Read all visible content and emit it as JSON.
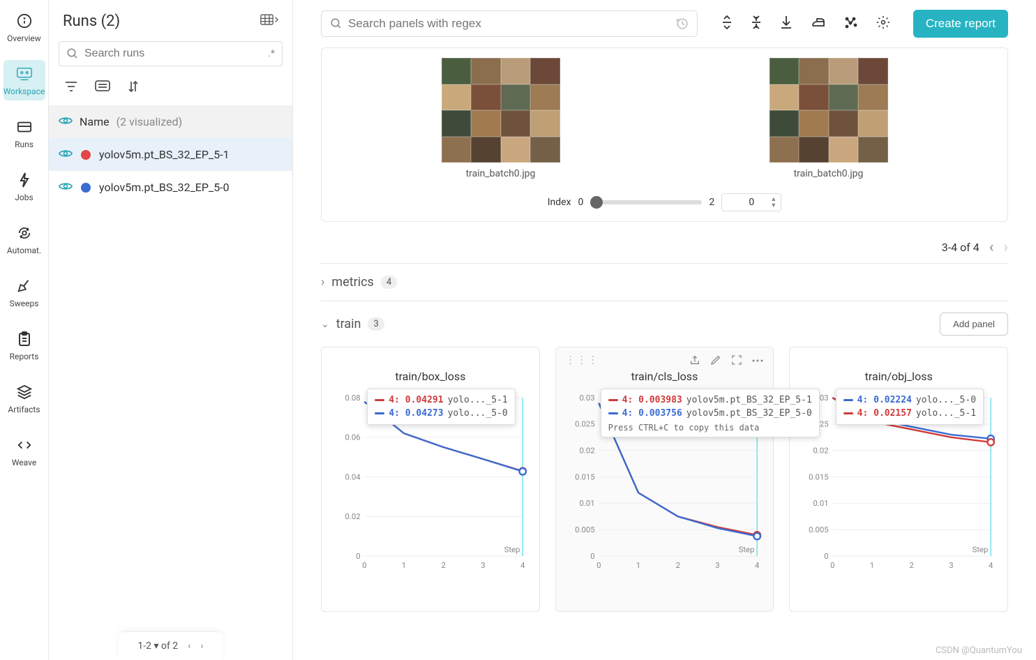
{
  "brand": "CSDN @QuantumYou",
  "nav": {
    "overview": "Overview",
    "workspace": "Workspace",
    "runs": "Runs",
    "jobs": "Jobs",
    "automat": "Automat.",
    "sweeps": "Sweeps",
    "reports": "Reports",
    "artifacts": "Artifacts",
    "weave": "Weave"
  },
  "runsPanel": {
    "title": "Runs (2)",
    "searchPlaceholder": "Search runs",
    "regex": ".*",
    "listHeader": "Name",
    "listCount": "(2 visualized)",
    "items": [
      {
        "name": "yolov5m.pt_BS_32_EP_5-1",
        "color": "#e34646",
        "selected": true
      },
      {
        "name": "yolov5m.pt_BS_32_EP_5-0",
        "color": "#3a6bd1",
        "selected": false
      }
    ],
    "footer": "1-2 ▾  of 2"
  },
  "topbar": {
    "searchPlaceholder": "Search panels with regex",
    "createReport": "Create report"
  },
  "mediaPanel": {
    "items": [
      {
        "caption": "train_batch0.jpg"
      },
      {
        "caption": "train_batch0.jpg"
      }
    ],
    "indexLabel": "Index",
    "indexMin": "0",
    "indexMax": "2",
    "indexValue": "0",
    "pagination": "3-4 of 4"
  },
  "sections": {
    "metrics": {
      "name": "metrics",
      "count": "4"
    },
    "train": {
      "name": "train",
      "count": "3",
      "addPanel": "Add panel"
    }
  },
  "chart_data": [
    {
      "type": "line",
      "title": "train/box_loss",
      "xlabel": "Step",
      "xlim": [
        0,
        4
      ],
      "ylim": [
        0,
        0.08
      ],
      "yticks": [
        0,
        0.02,
        0.04,
        0.06,
        0.08
      ],
      "x": [
        0,
        1,
        2,
        3,
        4
      ],
      "series": [
        {
          "name": "yolov5m.pt_BS_32_EP_5-1",
          "color": "#d13a3a",
          "values": [
            0.078,
            0.062,
            0.055,
            0.049,
            0.04291
          ]
        },
        {
          "name": "yolov5m.pt_BS_32_EP_5-0",
          "color": "#3a6bd1",
          "values": [
            0.078,
            0.062,
            0.055,
            0.049,
            0.04273
          ]
        }
      ],
      "cursor_x": 4,
      "tooltip": {
        "pos": "inside-right",
        "rows": [
          {
            "color": "#d13a3a",
            "step": "4",
            "value": "0.04291",
            "label": "yolo..._5-1"
          },
          {
            "color": "#3a6bd1",
            "step": "4",
            "value": "0.04273",
            "label": "yolo..._5-0"
          }
        ]
      }
    },
    {
      "type": "line",
      "title": "train/cls_loss",
      "xlabel": "Step",
      "xlim": [
        0,
        4
      ],
      "ylim": [
        0,
        0.03
      ],
      "yticks": [
        0,
        0.005,
        0.01,
        0.015,
        0.02,
        0.025,
        0.03
      ],
      "x": [
        0,
        1,
        2,
        3,
        4
      ],
      "series": [
        {
          "name": "yolov5m.pt_BS_32_EP_5-1",
          "color": "#d13a3a",
          "values": [
            0.029,
            0.012,
            0.0075,
            0.0055,
            0.003983
          ]
        },
        {
          "name": "yolov5m.pt_BS_32_EP_5-0",
          "color": "#3a6bd1",
          "values": [
            0.029,
            0.012,
            0.0075,
            0.0053,
            0.003756
          ]
        }
      ],
      "cursor_x": 4,
      "hover": true,
      "tooltip": {
        "pos": "overflow-left",
        "rows": [
          {
            "color": "#d13a3a",
            "step": "4",
            "value": "0.003983",
            "label": "yolov5m.pt_BS_32_EP_5-1"
          },
          {
            "color": "#3a6bd1",
            "step": "4",
            "value": "0.003756",
            "label": "yolov5m.pt_BS_32_EP_5-0"
          }
        ],
        "hint": "Press CTRL+C to copy this data"
      }
    },
    {
      "type": "line",
      "title": "train/obj_loss",
      "xlabel": "Step",
      "xlim": [
        0,
        4
      ],
      "ylim": [
        0,
        0.03
      ],
      "yticks": [
        0,
        0.005,
        0.01,
        0.015,
        0.02,
        0.025,
        0.03
      ],
      "x": [
        0,
        1,
        2,
        3,
        4
      ],
      "series": [
        {
          "name": "yolov5m.pt_BS_32_EP_5-0",
          "color": "#3a6bd1",
          "values": [
            0.03,
            0.026,
            0.0245,
            0.023,
            0.02224
          ]
        },
        {
          "name": "yolov5m.pt_BS_32_EP_5-1",
          "color": "#d13a3a",
          "values": [
            0.03,
            0.0255,
            0.024,
            0.0225,
            0.02157
          ]
        }
      ],
      "cursor_x": 4,
      "tooltip": {
        "pos": "inside-right",
        "rows": [
          {
            "color": "#3a6bd1",
            "step": "4",
            "value": "0.02224",
            "label": "yolo..._5-0"
          },
          {
            "color": "#d13a3a",
            "step": "4",
            "value": "0.02157",
            "label": "yolo..._5-1"
          }
        ]
      }
    }
  ],
  "thumbColors": [
    "#4a5d3f",
    "#8b6e4e",
    "#b99c7a",
    "#6b4837",
    "#c9a97c",
    "#7a503b",
    "#5e6a52",
    "#9c7b55",
    "#3e4b3a",
    "#a27a50",
    "#6e523d",
    "#bfa074",
    "#8d704f",
    "#564231",
    "#caa67e",
    "#746047"
  ]
}
